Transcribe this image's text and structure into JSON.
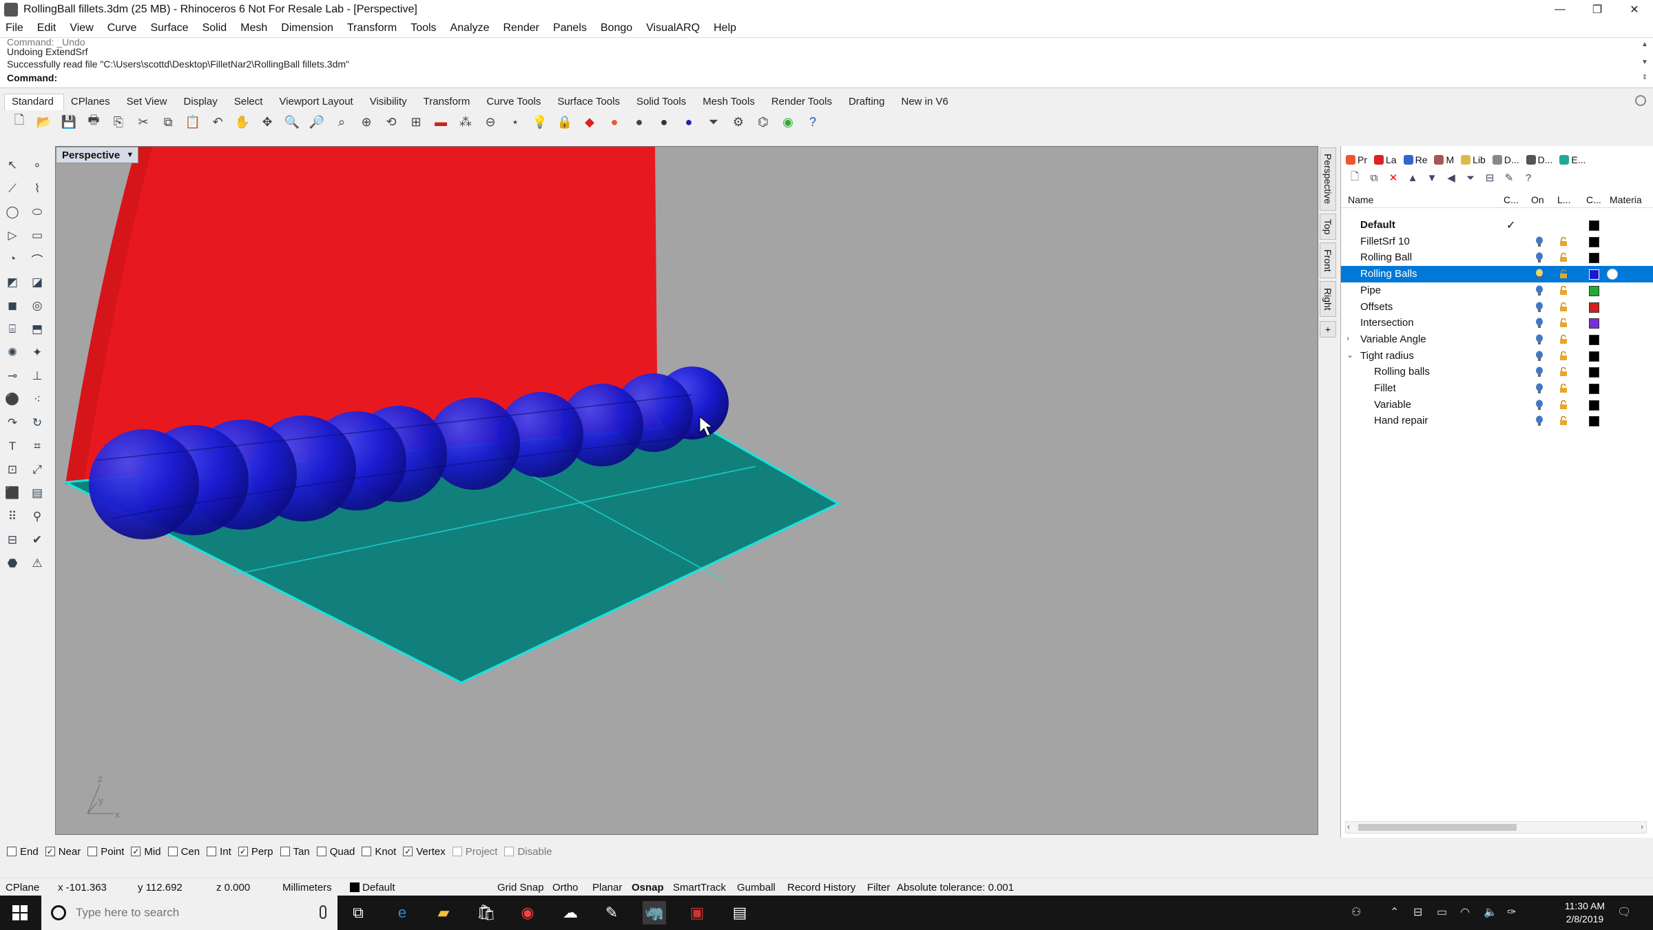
{
  "window": {
    "title": "RollingBall fillets.3dm (25 MB) - Rhinoceros 6 Not For Resale Lab - [Perspective]",
    "minimize": "—",
    "maximize": "❐",
    "close": "✕"
  },
  "menu": [
    "File",
    "Edit",
    "View",
    "Curve",
    "Surface",
    "Solid",
    "Mesh",
    "Dimension",
    "Transform",
    "Tools",
    "Analyze",
    "Render",
    "Panels",
    "Bongo",
    "VisualARQ",
    "Help"
  ],
  "command_history": [
    "Command: _Undo",
    "Undoing ExtendSrf",
    "Successfully read file \"C:\\Users\\scottd\\Desktop\\FilletNar2\\RollingBall fillets.3dm\""
  ],
  "command_prompt": "Command:",
  "command_value": "",
  "toolbar_tabs": [
    "Standard",
    "CPlanes",
    "Set View",
    "Display",
    "Select",
    "Viewport Layout",
    "Visibility",
    "Transform",
    "Curve Tools",
    "Surface Tools",
    "Solid Tools",
    "Mesh Tools",
    "Render Tools",
    "Drafting",
    "New in V6"
  ],
  "active_toolbar_tab": "Standard",
  "viewport": {
    "name": "Perspective",
    "axes": {
      "z": "z",
      "y": "y",
      "x": "x"
    },
    "colors": {
      "background": "#a4a4a4",
      "wall": "#e8191e",
      "plane": "#11807b",
      "edge": "#19e3e0",
      "balls": "#1a1acf"
    }
  },
  "side_tabs": [
    "Perspective",
    "Top",
    "Front",
    "Right"
  ],
  "panel": {
    "tabs": [
      "Pr",
      "La",
      "Re",
      "M",
      "Lib",
      "D...",
      "D...",
      "E..."
    ],
    "columns": {
      "name": "Name",
      "current": "C...",
      "on": "On",
      "lock": "L...",
      "color": "C...",
      "material": "Materia"
    },
    "layers": [
      {
        "name": "Default",
        "bold": true,
        "current": "✓",
        "color": "#000000",
        "level": 0
      },
      {
        "name": "FilletSrf 10",
        "color": "#000000",
        "level": 0
      },
      {
        "name": "Rolling Ball",
        "color": "#000000",
        "level": 0
      },
      {
        "name": "Rolling Balls",
        "color": "#1a1acf",
        "level": 0,
        "selected": true
      },
      {
        "name": "Pipe",
        "color": "#22aa33",
        "level": 0
      },
      {
        "name": "Offsets",
        "color": "#d41e1e",
        "level": 0
      },
      {
        "name": "Intersection",
        "color": "#7a2fd6",
        "level": 0
      },
      {
        "name": "Variable Angle",
        "color": "#000000",
        "level": 0,
        "expander": ">"
      },
      {
        "name": "Tight radius",
        "color": "#000000",
        "level": 0,
        "expander": "v"
      },
      {
        "name": "Rolling balls",
        "color": "#000000",
        "level": 1
      },
      {
        "name": "Fillet",
        "color": "#000000",
        "level": 1
      },
      {
        "name": "Variable",
        "color": "#000000",
        "level": 1
      },
      {
        "name": "Hand repair",
        "color": "#000000",
        "level": 1
      }
    ]
  },
  "osnaps": [
    {
      "label": "End",
      "checked": false
    },
    {
      "label": "Near",
      "checked": true
    },
    {
      "label": "Point",
      "checked": false
    },
    {
      "label": "Mid",
      "checked": true
    },
    {
      "label": "Cen",
      "checked": false
    },
    {
      "label": "Int",
      "checked": false
    },
    {
      "label": "Perp",
      "checked": true
    },
    {
      "label": "Tan",
      "checked": false
    },
    {
      "label": "Quad",
      "checked": false
    },
    {
      "label": "Knot",
      "checked": false
    },
    {
      "label": "Vertex",
      "checked": true
    },
    {
      "label": "Project",
      "checked": false,
      "disabled": true
    },
    {
      "label": "Disable",
      "checked": false,
      "disabled": true
    }
  ],
  "status": {
    "cplane": "CPlane",
    "x": "x -101.363",
    "y": "y 112.692",
    "z": "z 0.000",
    "units": "Millimeters",
    "layer": "Default",
    "grid_snap": "Grid Snap",
    "ortho": "Ortho",
    "planar": "Planar",
    "osnap": "Osnap",
    "smarttrack": "SmartTrack",
    "gumball": "Gumball",
    "record_history": "Record History",
    "filter": "Filter",
    "tolerance": "Absolute tolerance: 0.001"
  },
  "taskbar": {
    "search_placeholder": "Type here to search",
    "time": "11:30 AM",
    "date": "2/8/2019"
  }
}
